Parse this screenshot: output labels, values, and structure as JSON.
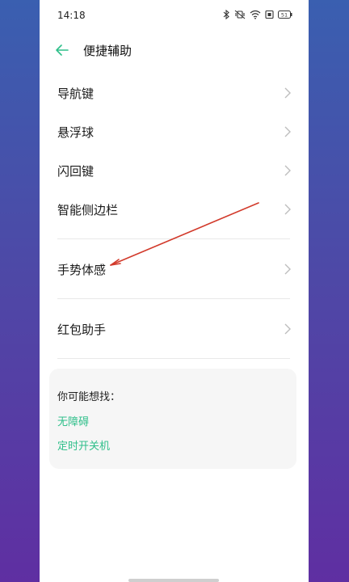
{
  "status_bar": {
    "time": "14:18",
    "icons": [
      "bluetooth-icon",
      "mute-vibrate-icon",
      "wifi-icon",
      "sim-icon",
      "battery-icon"
    ],
    "battery_level": "51"
  },
  "header": {
    "back_icon": "back-arrow-icon",
    "title": "便捷辅助"
  },
  "items": [
    {
      "label": "导航键"
    },
    {
      "label": "悬浮球"
    },
    {
      "label": "闪回键"
    },
    {
      "label": "智能侧边栏"
    },
    {
      "label": "手势体感"
    },
    {
      "label": "红包助手"
    }
  ],
  "suggestions": {
    "title": "你可能想找：",
    "links": [
      {
        "label": "无障碍"
      },
      {
        "label": "定时开关机"
      }
    ]
  },
  "colors": {
    "accent": "#2fbf8a",
    "annotation_line": "#d23a2b",
    "background_top": "#3a5fb0",
    "background_bottom": "#5f2fa2"
  }
}
